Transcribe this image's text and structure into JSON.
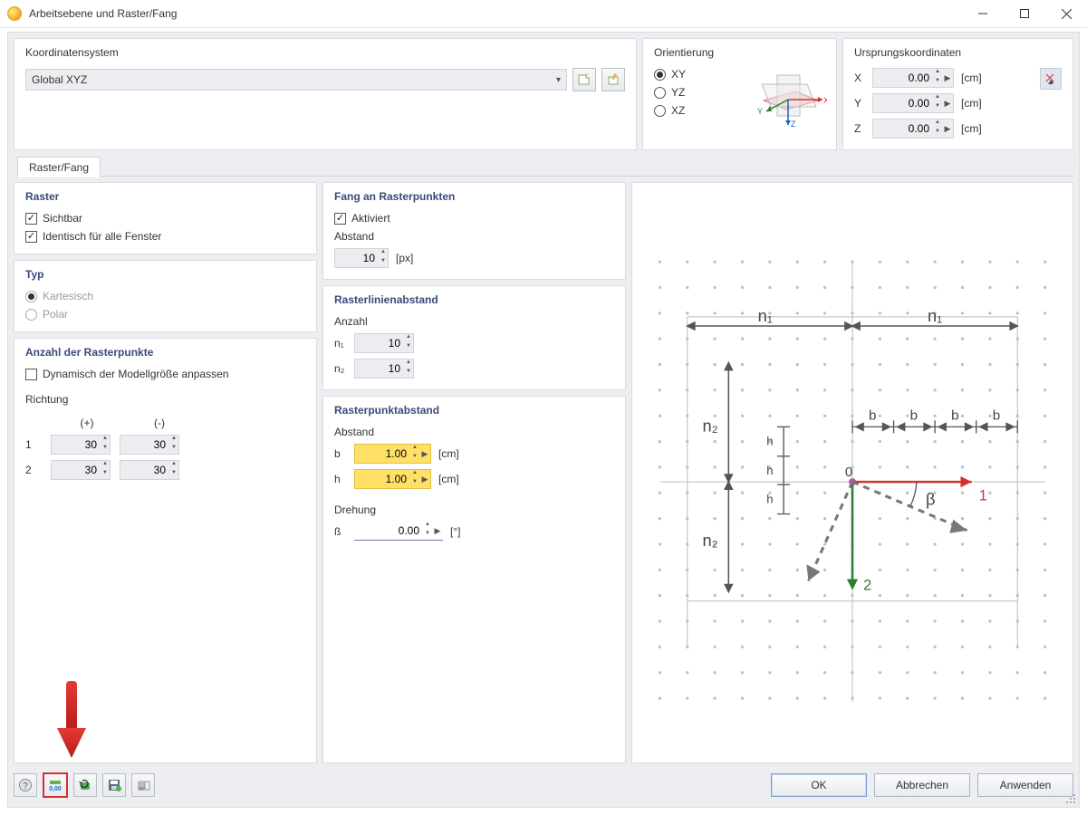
{
  "window": {
    "title": "Arbeitsebene und Raster/Fang"
  },
  "coord_system": {
    "title": "Koordinatensystem",
    "selected": "Global XYZ"
  },
  "orientation": {
    "title": "Orientierung",
    "options": [
      "XY",
      "YZ",
      "XZ"
    ],
    "selected": "XY"
  },
  "origin": {
    "title": "Ursprungskoordinaten",
    "x_label": "X",
    "x_value": "0.00",
    "y_label": "Y",
    "y_value": "0.00",
    "z_label": "Z",
    "z_value": "0.00",
    "unit": "[cm]"
  },
  "tab": {
    "label": "Raster/Fang"
  },
  "raster": {
    "title": "Raster",
    "visible_label": "Sichtbar",
    "identical_label": "Identisch für alle Fenster"
  },
  "type": {
    "title": "Typ",
    "cartesian": "Kartesisch",
    "polar": "Polar"
  },
  "num_points": {
    "title": "Anzahl der Rasterpunkte",
    "dynamic_label": "Dynamisch der Modellgröße anpassen",
    "direction_label": "Richtung",
    "plus": "(+)",
    "minus": "(-)",
    "row1": "1",
    "row2": "2",
    "r1_plus": "30",
    "r1_minus": "30",
    "r2_plus": "30",
    "r2_minus": "30"
  },
  "snap": {
    "title": "Fang an Rasterpunkten",
    "activated_label": "Aktiviert",
    "distance_label": "Abstand",
    "distance_value": "10",
    "distance_unit": "[px]"
  },
  "grid_spacing": {
    "title": "Rasterlinienabstand",
    "count_label": "Anzahl",
    "n1_label": "n₁",
    "n1_value": "10",
    "n2_label": "n₂",
    "n2_value": "10"
  },
  "point_spacing": {
    "title": "Rasterpunktabstand",
    "distance_label": "Abstand",
    "b_label": "b",
    "b_value": "1.00",
    "b_unit": "[cm]",
    "h_label": "h",
    "h_value": "1.00",
    "h_unit": "[cm]",
    "rotation_label": "Drehung",
    "beta_label": "ß",
    "beta_value": "0.00",
    "beta_unit": "[°]"
  },
  "buttons": {
    "ok": "OK",
    "cancel": "Abbrechen",
    "apply": "Anwenden"
  },
  "diagram": {
    "n1": "n₁",
    "n2": "n₂",
    "b": "b",
    "h": "h",
    "origin": "0",
    "beta": "β",
    "axis1": "1",
    "axis2": "2"
  }
}
